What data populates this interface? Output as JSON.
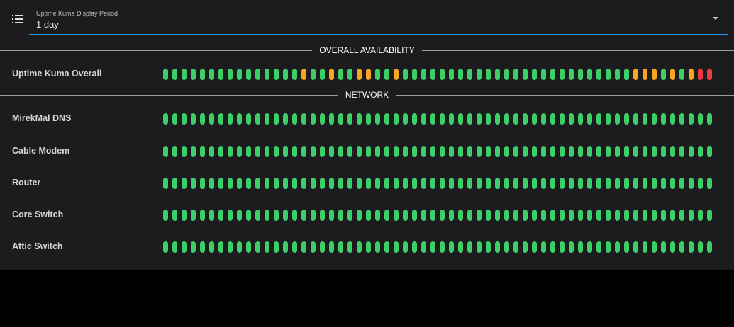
{
  "header": {
    "menu_icon": "menu-list-icon",
    "select_label": "Uptime Kuma Display Period",
    "select_value": "1 day"
  },
  "colors": {
    "up": "#3ccf67",
    "pending": "#f6a623",
    "down": "#f03a3f",
    "accent": "#2196f3"
  },
  "sections": [
    {
      "title": "OVERALL AVAILABILITY",
      "rows": [
        {
          "name": "Uptime Kuma Overall",
          "status": "GGGGGGGGGGGGGGGOGGOGGOOGGOGGGGGGGGGGGGGGGGGGGGGGGGGOOOGOGORR"
        }
      ]
    },
    {
      "title": "NETWORK",
      "rows": [
        {
          "name": "MirekMal DNS",
          "status": "GGGGGGGGGGGGGGGGGGGGGGGGGGGGGGGGGGGGGGGGGGGGGGGGGGGGGGGGGGGG"
        },
        {
          "name": "Cable Modem",
          "status": "GGGGGGGGGGGGGGGGGGGGGGGGGGGGGGGGGGGGGGGGGGGGGGGGGGGGGGGGGGGG"
        },
        {
          "name": "Router",
          "status": "GGGGGGGGGGGGGGGGGGGGGGGGGGGGGGGGGGGGGGGGGGGGGGGGGGGGGGGGGGGG"
        },
        {
          "name": "Core Switch",
          "status": "GGGGGGGGGGGGGGGGGGGGGGGGGGGGGGGGGGGGGGGGGGGGGGGGGGGGGGGGGGGG"
        },
        {
          "name": "Attic Switch",
          "status": "GGGGGGGGGGGGGGGGGGGGGGGGGGGGGGGGGGGGGGGGGGGGGGGGGGGGGGGGGGGG"
        }
      ]
    }
  ]
}
